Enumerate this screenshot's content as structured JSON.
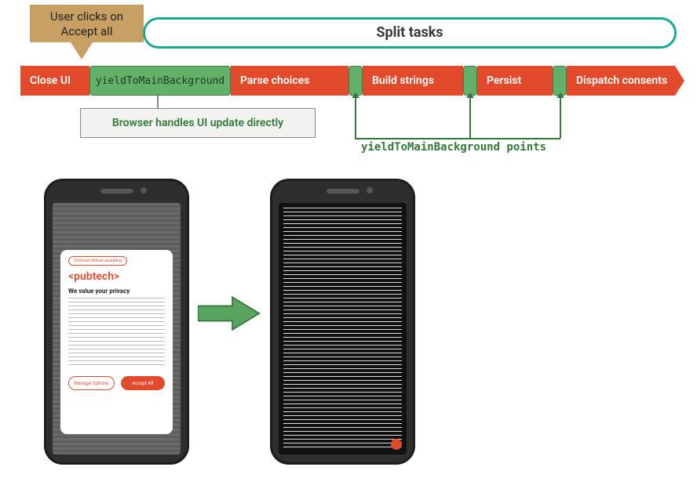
{
  "callout": {
    "line1": "User clicks on",
    "line2": "Accept all"
  },
  "split_pill": "Split tasks",
  "timeline": {
    "close_ui": "Close UI",
    "yield_chip": "yieldToMainBackground",
    "parse": "Parse choices",
    "build": "Build strings",
    "persist": "Persist",
    "dispatch": "Dispatch consents"
  },
  "handles_box": "Browser handles UI update directly",
  "yield_label": "yieldToMainBackground points",
  "phone_before": {
    "top_pill": "Continue without accepting",
    "logo": "<pubtech>",
    "headline": "We value your privacy",
    "manage_btn": "Manage Options",
    "accept_btn": "Accept All"
  }
}
